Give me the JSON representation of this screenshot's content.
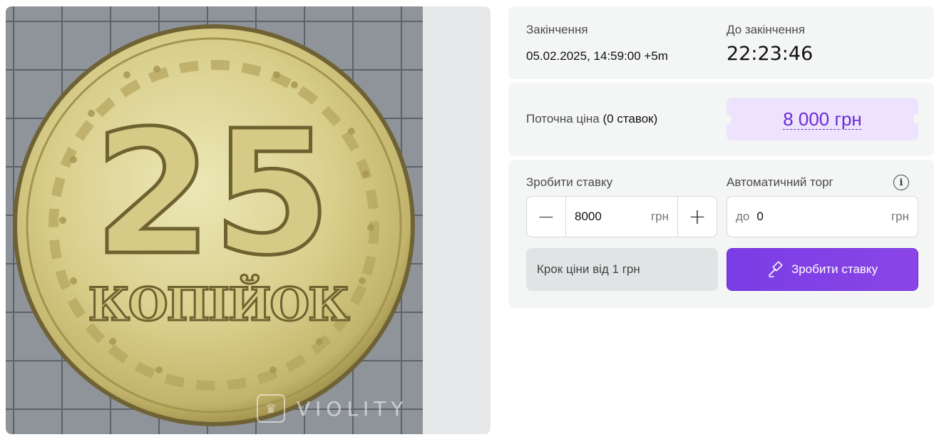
{
  "gallery": {
    "coin_denomination": "25",
    "coin_word": "КОПІЙОК",
    "watermark": "VIOLITY"
  },
  "auction": {
    "end_label": "Закінчення",
    "end_value": "05.02.2025, 14:59:00 +5m",
    "time_left_label": "До закінчення",
    "time_left_value": "22:23:46"
  },
  "price": {
    "label": "Поточна ціна",
    "bids": "(0 ставок)",
    "value": "8 000 грн"
  },
  "bid": {
    "label": "Зробити ставку",
    "minus": "−",
    "plus": "+",
    "amount": "8000",
    "unit": "грн",
    "auto_label": "Автоматичний торг",
    "info": "i",
    "auto_prefix": "до",
    "auto_value": "0",
    "auto_unit": "грн",
    "step_note": "Крок ціни від 1 грн",
    "button_label": "Зробити ставку"
  },
  "colors": {
    "accent": "#7a3de4",
    "price_bg": "#ede3fd",
    "price_text": "#6a2bd9"
  },
  "icons": [
    "minus-icon",
    "plus-icon",
    "info-icon",
    "gavel-icon",
    "crown-icon"
  ]
}
